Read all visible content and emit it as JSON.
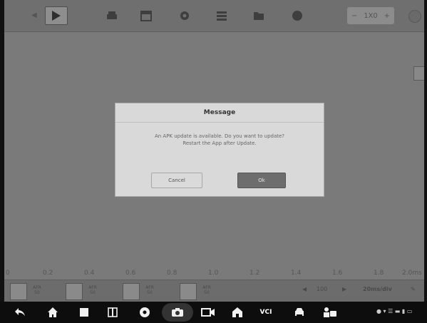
{
  "toolbar": {
    "zoom_minus": "−",
    "zoom_value": "1X0",
    "zoom_plus": "+",
    "icons": [
      "car-icon",
      "calendar-icon",
      "gear-icon",
      "list-icon",
      "folder-icon",
      "info-icon"
    ]
  },
  "ruler": {
    "labels": [
      "0",
      "0.2",
      "0.4",
      "0.6",
      "0.8",
      "1.0",
      "1.2",
      "1.4",
      "1.6",
      "1.8",
      "2.0ms"
    ]
  },
  "bottom_strip": {
    "channels": [
      {
        "line1": "AFR",
        "line2": "50"
      },
      {
        "line1": "AFR",
        "line2": "50"
      },
      {
        "line1": "AFR",
        "line2": "50"
      },
      {
        "line1": "AFR",
        "line2": "50"
      }
    ],
    "time_label": "100",
    "rate_label": "20ms/div"
  },
  "dialog": {
    "title": "Message",
    "message_line1": "An APK update is available. Do you want to update?",
    "message_line2": "Restart the App after Update.",
    "cancel_label": "Cancel",
    "ok_label": "Ok"
  },
  "navbar": {
    "vci_label": "VCI",
    "status_text": "● ▾ ☰ ▬ ▮ ▭"
  },
  "colors": {
    "screen_bg": "#7a7a7a",
    "dialog_bg": "#d9d9d9",
    "ok_button": "#6d6d6d",
    "navbar_bg": "#0d0d0d"
  }
}
